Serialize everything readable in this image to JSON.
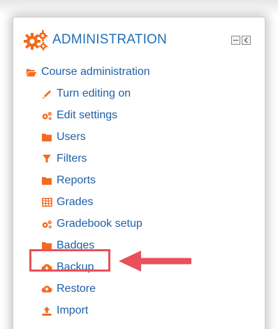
{
  "block": {
    "title": "ADMINISTRATION",
    "controls": [
      "minimize-icon",
      "dock-icon"
    ]
  },
  "tree": {
    "root": {
      "label": "Course administration",
      "icon": "folder-open-icon"
    },
    "items": [
      {
        "label": "Turn editing on",
        "icon": "pencil-icon"
      },
      {
        "label": "Edit settings",
        "icon": "cogs-icon"
      },
      {
        "label": "Users",
        "icon": "folder-icon"
      },
      {
        "label": "Filters",
        "icon": "filter-icon"
      },
      {
        "label": "Reports",
        "icon": "folder-icon"
      },
      {
        "label": "Grades",
        "icon": "table-icon"
      },
      {
        "label": "Gradebook setup",
        "icon": "cogs-icon"
      },
      {
        "label": "Badges",
        "icon": "folder-icon"
      },
      {
        "label": "Backup",
        "icon": "cloud-download-icon",
        "highlighted": true
      },
      {
        "label": "Restore",
        "icon": "cloud-upload-icon"
      },
      {
        "label": "Import",
        "icon": "upload-icon"
      }
    ]
  },
  "colors": {
    "link": "#1e5fa6",
    "title": "#1f6fb5",
    "icon": "#f46a1f",
    "highlight": "#e8505b"
  }
}
